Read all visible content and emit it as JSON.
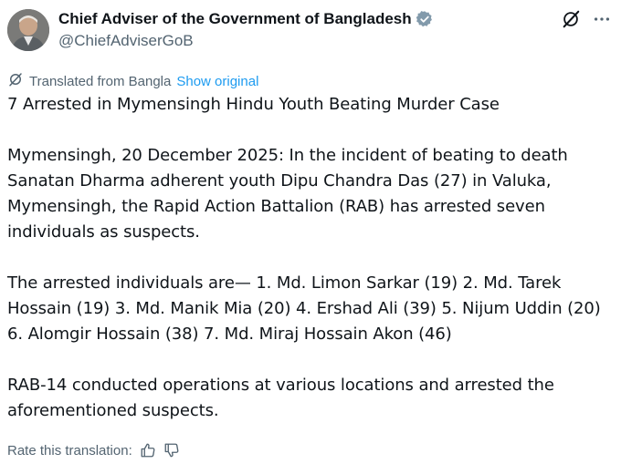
{
  "author": {
    "display_name": "Chief Adviser of the Government of Bangladesh",
    "handle": "@ChiefAdviserGoB",
    "verified_color": "#829aab"
  },
  "header_actions": {
    "icons": [
      "grok-icon",
      "more-icon"
    ]
  },
  "translation": {
    "label": "Translated from Bangla",
    "show_original": "Show original"
  },
  "post": {
    "title": "7 Arrested in Mymensingh Hindu Youth Beating Murder Case",
    "paragraph1": "Mymensingh, 20 December 2025: In the incident of beating to death Sanatan Dharma adherent youth Dipu Chandra Das (27) in Valuka, Mymensingh, the Rapid Action Battalion (RAB) has arrested seven individuals as suspects.",
    "paragraph2": "The arrested individuals are—  1. Md. Limon Sarkar (19) 2. Md. Tarek Hossain (19) 3. Md. Manik Mia (20) 4. Ershad Ali (39) 5. Nijum Uddin (20) 6. Alomgir Hossain (38) 7. Md. Miraj Hossain Akon (46)",
    "paragraph3": "RAB-14 conducted operations at various locations and arrested the aforementioned suspects."
  },
  "rating": {
    "label": "Rate this translation:",
    "icons": [
      "thumbs-up-icon",
      "thumbs-down-icon"
    ]
  },
  "colors": {
    "text_primary": "#0f1419",
    "text_secondary": "#536471",
    "link": "#1d9bf0"
  }
}
